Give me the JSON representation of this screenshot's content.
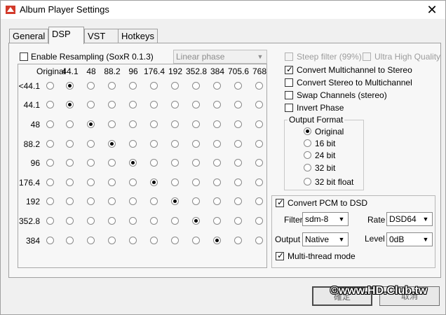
{
  "window": {
    "title": "Album Player Settings",
    "close_glyph": "✕"
  },
  "tabs": [
    {
      "label": "General",
      "active": false
    },
    {
      "label": "DSP",
      "active": true
    },
    {
      "label": "VST",
      "active": false
    },
    {
      "label": "Hotkeys",
      "active": false
    }
  ],
  "resampling": {
    "enable_label": "Enable Resampling  (SoxR 0.1.3)",
    "enabled": false,
    "phase_value": "Linear phase",
    "steep_filter_label": "Steep filter (99%)",
    "steep_filter_checked": false,
    "ultra_high_label": "Ultra High Quality",
    "ultra_high_checked": false
  },
  "matrix": {
    "columns": [
      "Original",
      "44.1",
      "48",
      "88.2",
      "96",
      "176.4",
      "192",
      "352.8",
      "384",
      "705.6",
      "768"
    ],
    "rows": [
      {
        "label": "<44.1",
        "selected": 1
      },
      {
        "label": "44.1",
        "selected": 1
      },
      {
        "label": "48",
        "selected": 2
      },
      {
        "label": "88.2",
        "selected": 3
      },
      {
        "label": "96",
        "selected": 4
      },
      {
        "label": "176.4",
        "selected": 5
      },
      {
        "label": "192",
        "selected": 6
      },
      {
        "label": "352.8",
        "selected": 7
      },
      {
        "label": "384",
        "selected": 8
      }
    ]
  },
  "options": {
    "multichannel_to_stereo": {
      "label": "Convert Multichannel to Stereo",
      "checked": true
    },
    "stereo_to_multichannel": {
      "label": "Convert Stereo to Multichannel",
      "checked": false
    },
    "swap_channels": {
      "label": "Swap Channels (stereo)",
      "checked": false
    },
    "invert_phase": {
      "label": "Invert Phase",
      "checked": false
    }
  },
  "output_format": {
    "title": "Output Format",
    "options": [
      "Original",
      "16 bit",
      "24 bit",
      "32 bit",
      "32 bit float"
    ],
    "selected": 0
  },
  "dsd": {
    "convert_label": "Convert PCM to DSD",
    "convert_checked": true,
    "filter_label": "Filter",
    "filter_value": "sdm-8",
    "rate_label": "Rate",
    "rate_value": "DSD64",
    "output_label": "Output",
    "output_value": "Native",
    "level_label": "Level",
    "level_value": "0dB",
    "multithread_label": "Multi-thread mode",
    "multithread_checked": true
  },
  "buttons": {
    "ok_label": "確定",
    "cancel_label": "取消"
  },
  "watermark": "©www.HD.Club.tw",
  "check_glyph": "✓",
  "arrow_glyph": "▼"
}
